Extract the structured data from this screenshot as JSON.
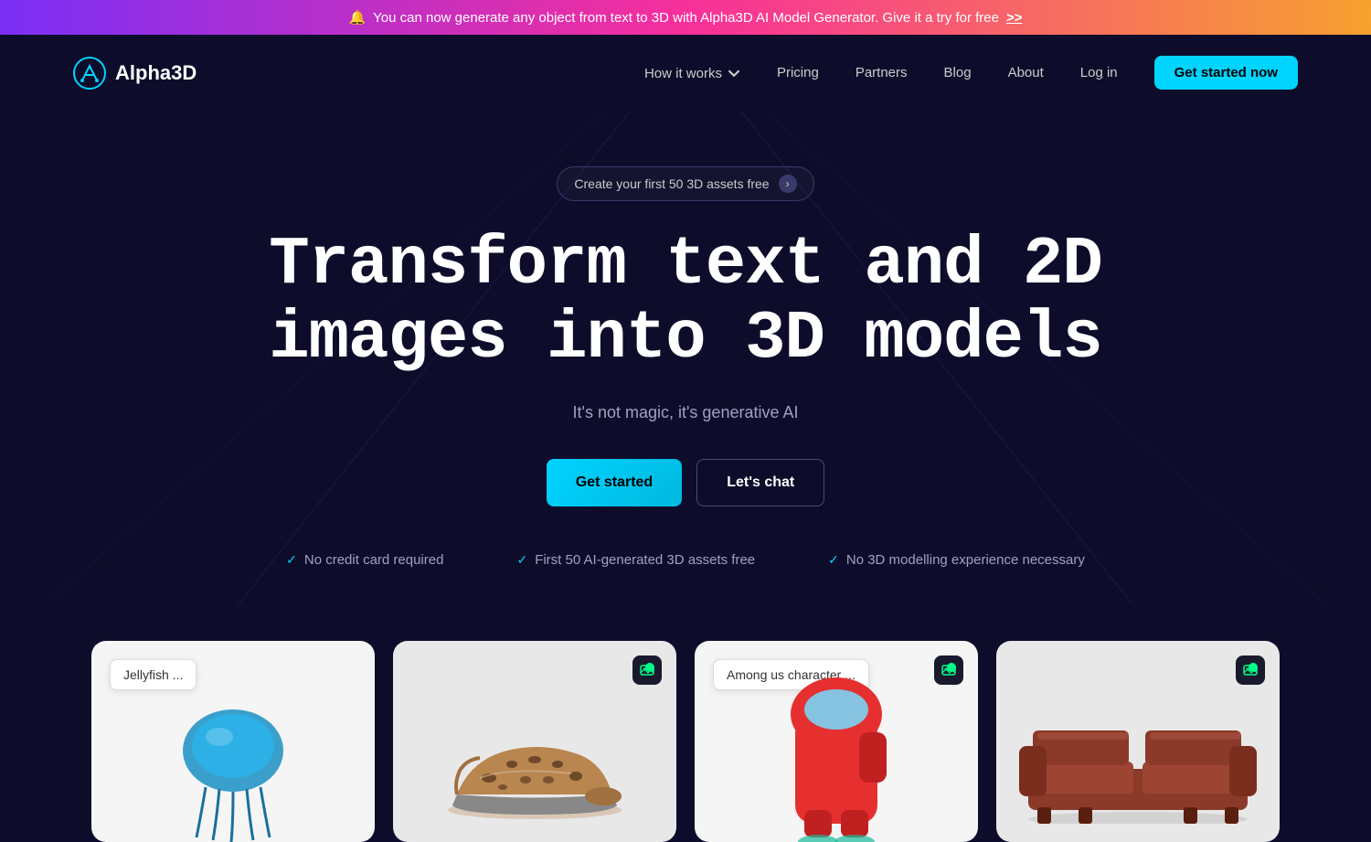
{
  "announcement": {
    "bell": "🔔",
    "text": "You can now generate any object from text to 3D with Alpha3D AI Model Generator. Give it a try for free",
    "link_text": ">>"
  },
  "nav": {
    "logo_text": "Alpha3D",
    "links": [
      {
        "id": "how-it-works",
        "label": "How it works",
        "has_dropdown": true
      },
      {
        "id": "pricing",
        "label": "Pricing"
      },
      {
        "id": "partners",
        "label": "Partners"
      },
      {
        "id": "blog",
        "label": "Blog"
      },
      {
        "id": "about",
        "label": "About"
      },
      {
        "id": "login",
        "label": "Log in"
      }
    ],
    "cta_label": "Get started now"
  },
  "hero": {
    "badge_text": "Create your first 50 3D assets free",
    "title_line1": "Transform text and 2D",
    "title_line2": "images into 3D models",
    "subtitle": "It's not magic, it's generative AI",
    "btn_get_started": "Get started",
    "btn_lets_chat": "Let's chat",
    "features": [
      {
        "id": "no-cc",
        "text": "No credit card required"
      },
      {
        "id": "free-assets",
        "text": "First 50 AI-generated 3D assets free"
      },
      {
        "id": "no-exp",
        "text": "No 3D modelling experience necessary"
      }
    ]
  },
  "cards": [
    {
      "id": "jellyfish",
      "input_text": "Jellyfish ...",
      "has_badge": false
    },
    {
      "id": "shoe",
      "input_text": null,
      "has_badge": true
    },
    {
      "id": "among-us",
      "input_text": "Among us character ...",
      "has_badge": true
    },
    {
      "id": "sofa",
      "input_text": null,
      "has_badge": true
    }
  ]
}
